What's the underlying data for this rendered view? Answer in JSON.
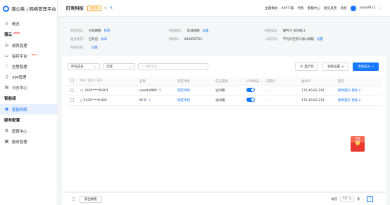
{
  "brand": {
    "name": "蒲公英 | 网络管理平台"
  },
  "sidebar": {
    "overview": "概览",
    "group1": {
      "label": "蒲云",
      "badge": "beta"
    },
    "items1": [
      {
        "label": "成员管理",
        "icon": "users-icon"
      },
      {
        "label": "监控平台",
        "icon": "monitor-icon",
        "badge": "beta"
      },
      {
        "label": "告警管理",
        "icon": "bell-icon"
      },
      {
        "label": "SIM管理",
        "icon": "sim-icon"
      },
      {
        "label": "日志中心",
        "icon": "log-icon"
      }
    ],
    "group2": "智能组",
    "items2": [
      {
        "label": "智能网络",
        "icon": "network-icon"
      }
    ],
    "group3": "服务配置",
    "items3": [
      {
        "label": "配置中心",
        "icon": "config-icon"
      },
      {
        "label": "服务管理",
        "icon": "service-icon"
      }
    ]
  },
  "header": {
    "company": "盯有科技",
    "badge": "旗舰版",
    "links": [
      "主题模式",
      "APP下载",
      "代购",
      "客服中心",
      "意见反馈",
      "消息"
    ],
    "username": "zyou0612"
  },
  "info": {
    "type_key": "网络类型：",
    "type_val": "对等网络",
    "type_link": "修改",
    "mode_key": "组网模式：",
    "mode_val": "标准组网",
    "mode_link": "设置",
    "member_key": "网络成员：",
    "member_val": "硬件 0   访问端 2",
    "svc_key": "服务要求：",
    "svc_val": "已开启",
    "svc_link": "关闭",
    "id_key": "网络ID：",
    "id_val": "845855733",
    "join_key": "入网方式：",
    "join_val": "不允许任何人加入网络",
    "join_link": "设置",
    "res_key": "网络资源：",
    "res_link": "设置"
  },
  "filters": {
    "members": "所有成员",
    "all": "全部",
    "search_placeholder": "搜索成员"
  },
  "tools": {
    "columns": "显示列",
    "net_settings": "组网设置",
    "add_member": "添加成员"
  },
  "table": {
    "headers": [
      "SN / UID / SID",
      "名称",
      "绑定手机",
      "成员属性",
      "VPN状态",
      "内网IP",
      "虚拟IP",
      "操作"
    ],
    "rows": [
      {
        "sn": "2435****8:001",
        "name": "xiaodeMBP",
        "phone": "绑定手机",
        "attr": "访问端",
        "lan": "-",
        "vip": "172.40.83.191",
        "op_edit": "修改密码",
        "op_more": "更多"
      },
      {
        "sn": "2435****8:002",
        "name": "Mi 9",
        "phone": "绑定手机",
        "attr": "访问端",
        "lan": "-",
        "vip": "172.40.83.221",
        "op_edit": "修改密码",
        "op_more": "更多"
      }
    ]
  },
  "footer": {
    "remove": "移出网络",
    "total": "每页",
    "per_page": "15",
    "unit": "条",
    "page": "1"
  },
  "promo": {
    "text": "有奖\n反馈"
  },
  "colors": {
    "accent": "#1677ff",
    "badge": "#f0a020",
    "promo": "#e8382f"
  }
}
